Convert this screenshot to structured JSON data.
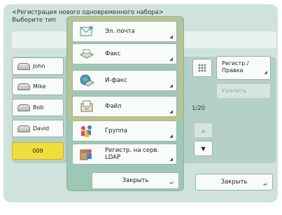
{
  "header": {
    "line1": "<Регистрация нового одновременного набора>",
    "line2": "Выберите тип"
  },
  "address_list": {
    "entries": [
      "John",
      "Mike",
      "Bob",
      "David"
    ],
    "selected_entry": "009"
  },
  "side_buttons": {
    "register_edit": "Регистр./ Правка",
    "delete": "Удалить"
  },
  "pager": {
    "counter": "1/20"
  },
  "close_main": "Закрыть",
  "popup": {
    "items": [
      {
        "label": "Эл. почта",
        "icon": "email-icon"
      },
      {
        "label": "Факс",
        "icon": "fax-icon"
      },
      {
        "label": "И-факс",
        "icon": "ifax-icon"
      },
      {
        "label": "Файл",
        "icon": "file-icon"
      },
      {
        "label": "Группа",
        "icon": "group-icon"
      },
      {
        "label": "Регистр. на серв. LDAP",
        "icon": "ldap-server-icon"
      }
    ],
    "close": "Закрыть"
  },
  "colors": {
    "screen_bg": "#cfe3dc",
    "popup_bg": "#9fc7b6",
    "highlight": "#f2b93b",
    "selected_row": "#f0de3c"
  }
}
